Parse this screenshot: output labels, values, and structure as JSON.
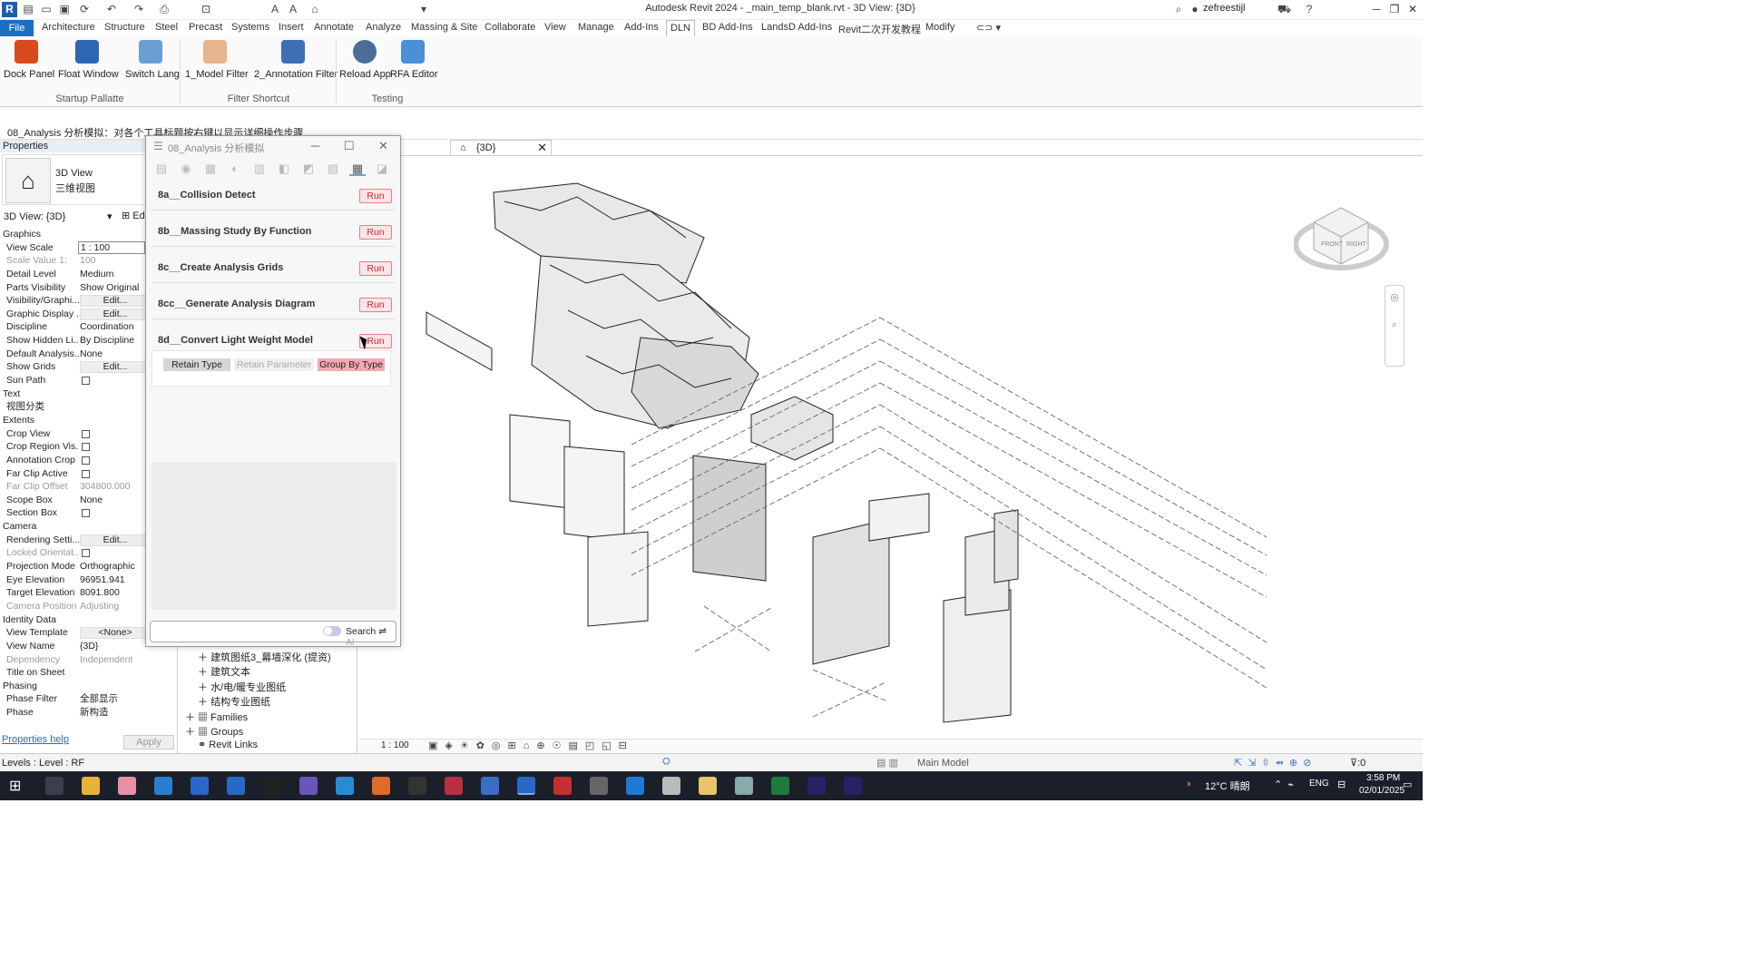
{
  "app": {
    "title": "Autodesk Revit 2024 - _main_temp_blank.rvt - 3D View: {3D}",
    "user": "zefreestijl",
    "logo": "R"
  },
  "ribbon_tabs": [
    "File",
    "Architecture",
    "Structure",
    "Steel",
    "Precast",
    "Systems",
    "Insert",
    "Annotate",
    "Analyze",
    "Massing & Site",
    "Collaborate",
    "View",
    "Manage",
    "Add-Ins",
    "DLN",
    "BD Add-Ins",
    "LandsD Add-Ins",
    "Revit二次开发教程",
    "Modify"
  ],
  "ribbon": {
    "buttons": [
      {
        "label": "Dock Panel",
        "icon": "dock-panel-icon"
      },
      {
        "label": "Float Window",
        "icon": "float-window-icon"
      },
      {
        "label": "Switch Lang",
        "icon": "switch-lang-icon"
      },
      {
        "label": "1_Model Filter",
        "icon": "model-filter-icon"
      },
      {
        "label": "2_Annotation Filter",
        "icon": "annotation-filter-icon"
      },
      {
        "label": "Reload App",
        "icon": "reload-app-icon"
      },
      {
        "label": "RFA Editor",
        "icon": "rfa-editor-icon"
      }
    ],
    "groups": [
      "Startup Pallatte",
      "Filter Shortcut",
      "Testing"
    ]
  },
  "options_bar": "08_Analysis 分析模拟：对各个工具标题按右键以显示详细操作步骤",
  "properties": {
    "header": "Properties",
    "type_name": "3D View",
    "type_sub": "三维视图",
    "selector": "3D View: {3D}",
    "edit_type": "Ed",
    "rows": [
      {
        "kind": "cat",
        "name": "Graphics"
      },
      {
        "name": "View Scale",
        "field": "1 : 100"
      },
      {
        "name": "Scale Value    1:",
        "value": "100",
        "grey": true
      },
      {
        "name": "Detail Level",
        "value": "Medium"
      },
      {
        "name": "Parts Visibility",
        "value": "Show Original"
      },
      {
        "name": "Visibility/Graphi...",
        "button": "Edit..."
      },
      {
        "name": "Graphic Display ...",
        "button": "Edit..."
      },
      {
        "name": "Discipline",
        "value": "Coordination"
      },
      {
        "name": "Show Hidden Li...",
        "value": "By Discipline"
      },
      {
        "name": "Default Analysis...",
        "value": "None"
      },
      {
        "name": "Show Grids",
        "button": "Edit..."
      },
      {
        "name": "Sun Path",
        "check": true
      },
      {
        "kind": "cat",
        "name": "Text"
      },
      {
        "name": "视图分类",
        "value": ""
      },
      {
        "kind": "cat",
        "name": "Extents"
      },
      {
        "name": "Crop View",
        "check": true
      },
      {
        "name": "Crop Region Vis...",
        "check": true
      },
      {
        "name": "Annotation Crop",
        "check": true
      },
      {
        "name": "Far Clip Active",
        "check": true
      },
      {
        "name": "Far Clip Offset",
        "value": "304800.000",
        "grey": true
      },
      {
        "name": "Scope Box",
        "value": "None"
      },
      {
        "name": "Section Box",
        "check": true
      },
      {
        "kind": "cat",
        "name": "Camera"
      },
      {
        "name": "Rendering Setti...",
        "button": "Edit..."
      },
      {
        "name": "Locked Orientat...",
        "check": true,
        "grey": true
      },
      {
        "name": "Projection Mode",
        "value": "Orthographic"
      },
      {
        "name": "Eye Elevation",
        "value": "96951.941"
      },
      {
        "name": "Target Elevation",
        "value": "8091.800"
      },
      {
        "name": "Camera Position",
        "value": "Adjusting",
        "grey": true
      },
      {
        "kind": "cat",
        "name": "Identity Data"
      },
      {
        "name": "View Template",
        "button": "<None>"
      },
      {
        "name": "View Name",
        "value": "{3D}"
      },
      {
        "name": "Dependency",
        "value": "Independent",
        "grey": true
      },
      {
        "name": "Title on Sheet",
        "value": ""
      },
      {
        "kind": "cat",
        "name": "Phasing"
      },
      {
        "name": "Phase Filter",
        "value": "全部显示"
      },
      {
        "name": "Phase",
        "value": "新构造"
      }
    ],
    "help": "Properties help",
    "apply": "Apply"
  },
  "project_browser": {
    "items": [
      "建筑图纸3_幕墙深化 (提资)",
      "建筑文本",
      "水/电/暖专业图纸",
      "结构专业图纸",
      "Families",
      "Groups",
      "Revit Links"
    ]
  },
  "view": {
    "tab": "{3D}",
    "scale": "1 : 100"
  },
  "dialog": {
    "title": "08_Analysis 分析模拟",
    "tools": [
      {
        "label": "8a__Collision Detect",
        "run": "Run"
      },
      {
        "label": "8b__Massing Study By Function",
        "run": "Run"
      },
      {
        "label": "8c__Create Analysis Grids",
        "run": "Run"
      },
      {
        "label": "8cc__Generate Analysis Diagram",
        "run": "Run"
      },
      {
        "label": "8d__Convert Light Weight Model",
        "run": "Run"
      }
    ],
    "options": [
      "Retain Type",
      "Retain Parameter",
      "Group By Type"
    ],
    "search": "Search",
    "search_suffix": "Al"
  },
  "statusbar": {
    "text": "Levels : Level : RF",
    "model": "Main Model",
    "filter_count": ":0"
  },
  "taskbar": {
    "weather": "12°C 晴朗",
    "lang": "ENG",
    "time": "3:58 PM",
    "date": "02/01/2025"
  },
  "colors": {
    "accent": "#1b6ec2",
    "run_bg": "#fde4e6",
    "run_border": "#e28088",
    "run_text": "#c82a36"
  }
}
